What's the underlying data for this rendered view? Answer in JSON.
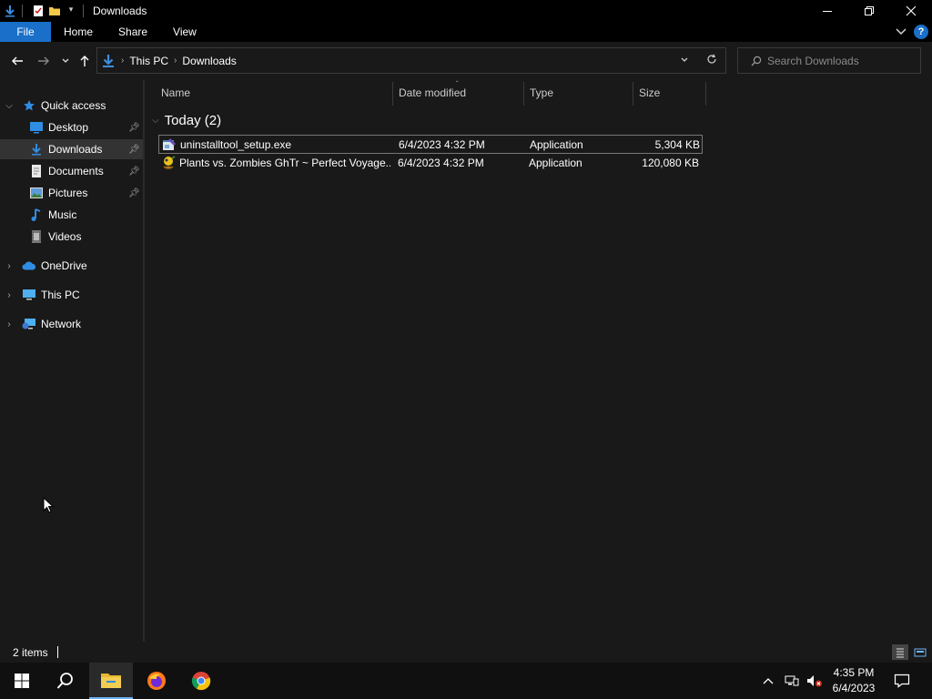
{
  "window": {
    "title": "Downloads",
    "controls": {
      "minimize": "—",
      "maximize": "❐",
      "close": "✕"
    }
  },
  "ribbon": {
    "tabs": [
      "File",
      "Home",
      "Share",
      "View"
    ],
    "expand_icon": "chevron-down-icon",
    "help": "?"
  },
  "address": {
    "path": [
      "This PC",
      "Downloads"
    ],
    "refresh_icon": "refresh-icon"
  },
  "search": {
    "placeholder": "Search Downloads"
  },
  "nav": {
    "quick_access": "Quick access",
    "quick_items": [
      {
        "label": "Desktop",
        "pinned": true
      },
      {
        "label": "Downloads",
        "pinned": true,
        "selected": true
      },
      {
        "label": "Documents",
        "pinned": true
      },
      {
        "label": "Pictures",
        "pinned": true
      },
      {
        "label": "Music",
        "pinned": false
      },
      {
        "label": "Videos",
        "pinned": false
      }
    ],
    "roots": [
      "OneDrive",
      "This PC",
      "Network"
    ]
  },
  "columns": {
    "name": "Name",
    "date": "Date modified",
    "type": "Type",
    "size": "Size"
  },
  "group": {
    "label": "Today (2)"
  },
  "files": [
    {
      "name": "uninstalltool_setup.exe",
      "date": "6/4/2023 4:32 PM",
      "type": "Application",
      "size": "5,304 KB",
      "selected": true
    },
    {
      "name": "Plants vs. Zombies GhTr ~ Perfect Voyage...",
      "date": "6/4/2023 4:32 PM",
      "type": "Application",
      "size": "120,080 KB",
      "selected": false
    }
  ],
  "status": {
    "items": "2 items"
  },
  "taskbar": {
    "apps": [
      "start-icon",
      "search-icon",
      "file-explorer-icon",
      "firefox-icon",
      "chrome-icon"
    ],
    "clock": {
      "time": "4:35 PM",
      "date": "6/4/2023"
    }
  },
  "colors": {
    "accent": "#1a6fc9",
    "background": "#191919",
    "taskbar": "#101010"
  }
}
